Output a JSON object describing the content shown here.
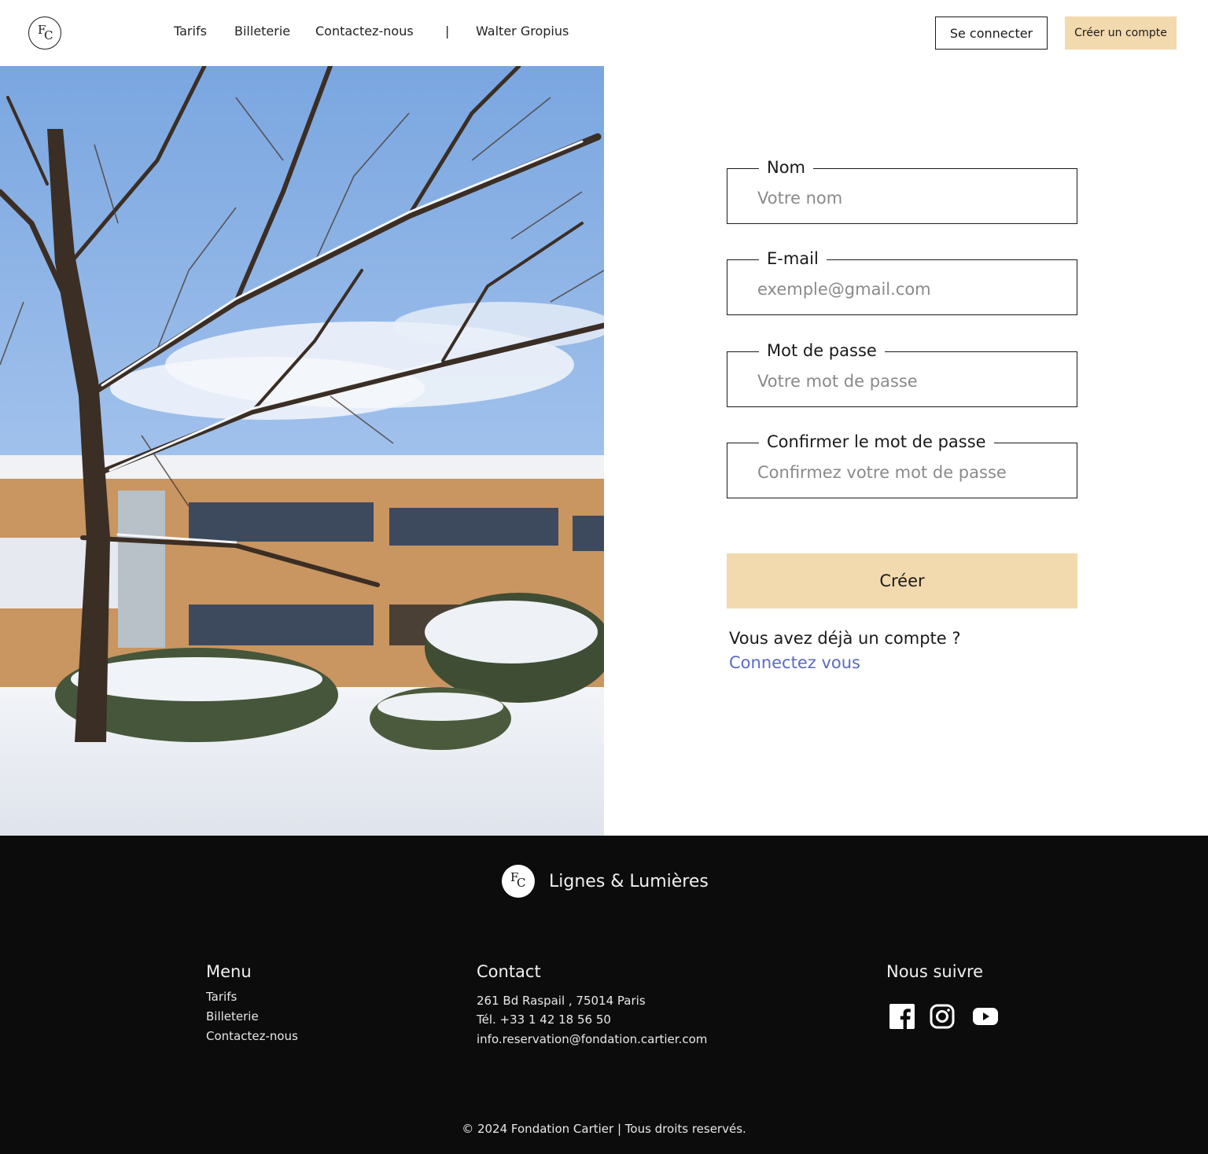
{
  "header": {
    "logo_letters": {
      "f": "F",
      "c": "C"
    },
    "nav": [
      "Tarifs",
      "Billeterie",
      "Contactez-nous"
    ],
    "separator": "|",
    "artist": "Walter Gropius",
    "login_label": "Se connecter",
    "signup_label": "Créer un compte"
  },
  "form": {
    "name_label": "Nom",
    "name_placeholder": "Votre nom",
    "email_label": "E-mail",
    "email_placeholder": "exemple@gmail.com",
    "password_label": "Mot de passe",
    "password_placeholder": "Votre mot de passe",
    "confirm_label": "Confirmer le mot de passe",
    "confirm_placeholder": "Confirmez votre mot de passe",
    "submit_label": "Créer",
    "already_text": "Vous avez déjà un compte ?",
    "login_link": "Connectez vous"
  },
  "footer": {
    "brand": "Lignes & Lumières",
    "menu_heading": "Menu",
    "menu_items": [
      "Tarifs",
      "Billeterie",
      "Contactez-nous"
    ],
    "contact_heading": "Contact",
    "address": "261 Bd Raspail , 75014 Paris",
    "phone": "Tél. +33 1 42 18 56 50",
    "email": "info.reservation@fondation.cartier.com",
    "follow_heading": "Nous suivre",
    "social_icons": [
      "facebook-icon",
      "instagram-icon",
      "youtube-icon"
    ],
    "copyright": "© 2024 Fondation Cartier | Tous droits reservés."
  },
  "colors": {
    "accent": "#f2d9ae",
    "link": "#5a6bc4",
    "footer_bg": "#0c0c0c"
  }
}
